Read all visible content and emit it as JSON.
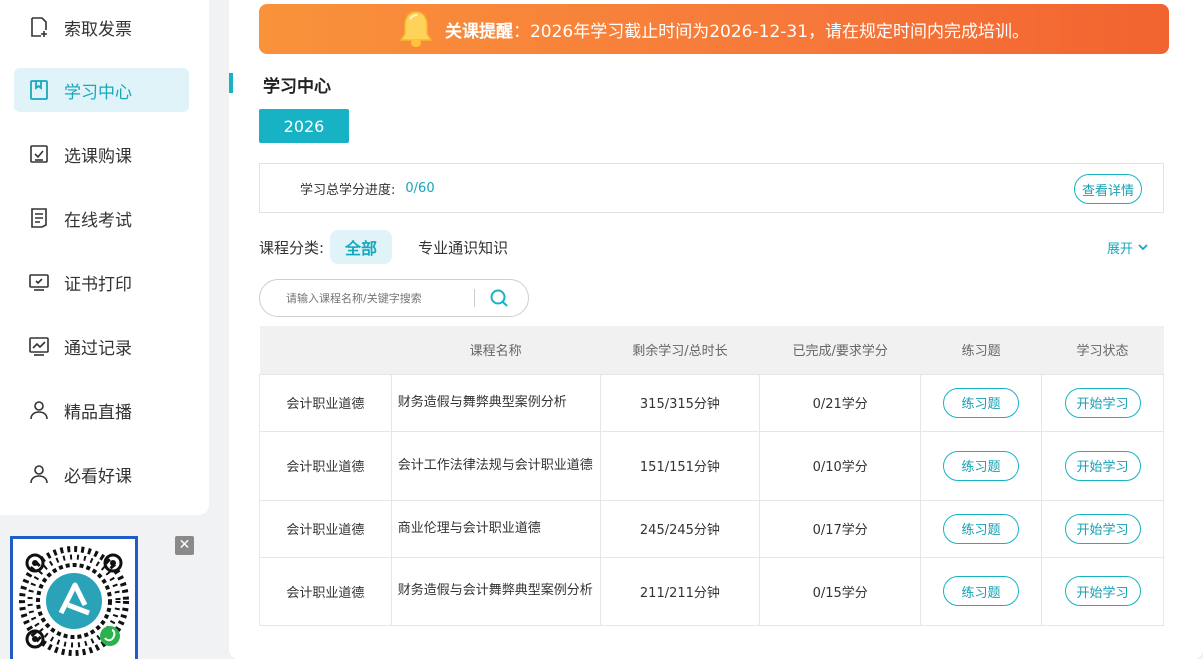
{
  "sidebar": {
    "items": [
      {
        "label": "索取发票",
        "icon": "invoice-icon",
        "active": false
      },
      {
        "label": "学习中心",
        "icon": "book-icon",
        "active": true
      },
      {
        "label": "选课购课",
        "icon": "checkbox-icon",
        "active": false
      },
      {
        "label": "在线考试",
        "icon": "exam-icon",
        "active": false
      },
      {
        "label": "证书打印",
        "icon": "certificate-icon",
        "active": false
      },
      {
        "label": "通过记录",
        "icon": "chart-icon",
        "active": false
      },
      {
        "label": "精品直播",
        "icon": "user-icon",
        "active": false
      },
      {
        "label": "必看好课",
        "icon": "user-icon",
        "active": false
      }
    ]
  },
  "qr": {
    "close_label": "✕"
  },
  "banner": {
    "prefix": "关课提醒",
    "text": "：2026年学习截止时间为2026-12-31，请在规定时间内完成培训。"
  },
  "main": {
    "title": "学习中心",
    "year": "2026",
    "progress_label": "学习总学分进度:",
    "progress_value": "0/60",
    "detail_button": "查看详情",
    "category_label": "课程分类:",
    "category_all": "全部",
    "category_other": "专业通识知识",
    "expand_label": "展开",
    "search_placeholder": "请输入课程名称/关键字搜索"
  },
  "table": {
    "headers": [
      "",
      "课程名称",
      "剩余学习/总时长",
      "已完成/要求学分",
      "练习题",
      "学习状态"
    ],
    "rows": [
      {
        "category": "会计职业道德",
        "name": "财务造假与舞弊典型案例分析",
        "duration": "315/315分钟",
        "credits": "0/21学分",
        "exercise": "练习题",
        "status": "开始学习"
      },
      {
        "category": "会计职业道德",
        "name": "会计工作法律法规与会计职业道德",
        "duration": "151/151分钟",
        "credits": "0/10学分",
        "exercise": "练习题",
        "status": "开始学习"
      },
      {
        "category": "会计职业道德",
        "name": "商业伦理与会计职业道德",
        "duration": "245/245分钟",
        "credits": "0/17学分",
        "exercise": "练习题",
        "status": "开始学习"
      },
      {
        "category": "会计职业道德",
        "name": "财务造假与会计舞弊典型案例分析",
        "duration": "211/211分钟",
        "credits": "0/15学分",
        "exercise": "练习题",
        "status": "开始学习"
      }
    ]
  },
  "colors": {
    "accent": "#17b3c4",
    "banner_start": "#f9923a",
    "banner_end": "#f2632f"
  }
}
